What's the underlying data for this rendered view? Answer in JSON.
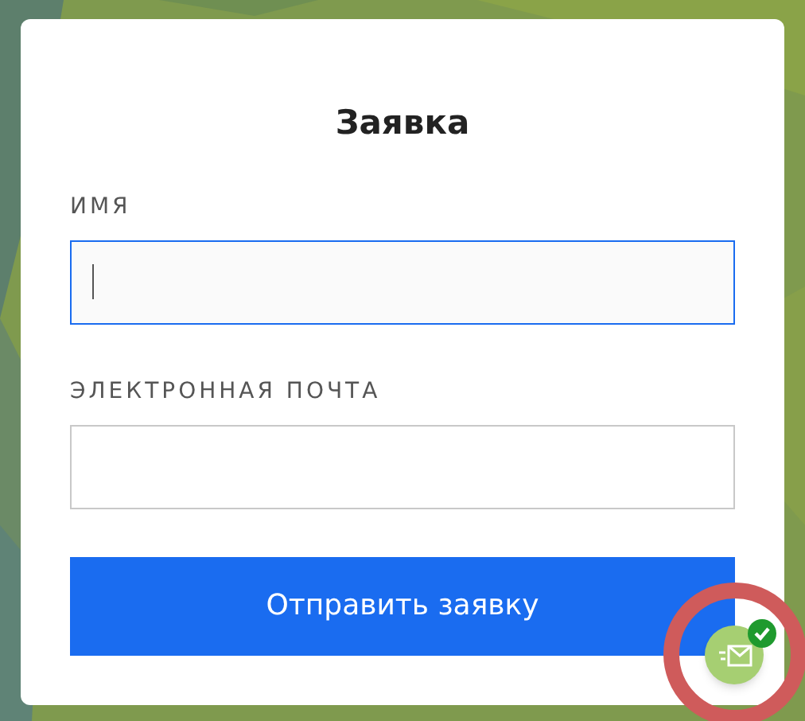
{
  "form": {
    "title": "Заявка",
    "fields": [
      {
        "label": "ИМЯ",
        "focused": true
      },
      {
        "label": "ЭЛЕКТРОННАЯ ПОЧТА",
        "focused": false
      }
    ],
    "submit": "Отправить заявку"
  },
  "chat_widget": {
    "sent": true,
    "highlighted": true
  }
}
